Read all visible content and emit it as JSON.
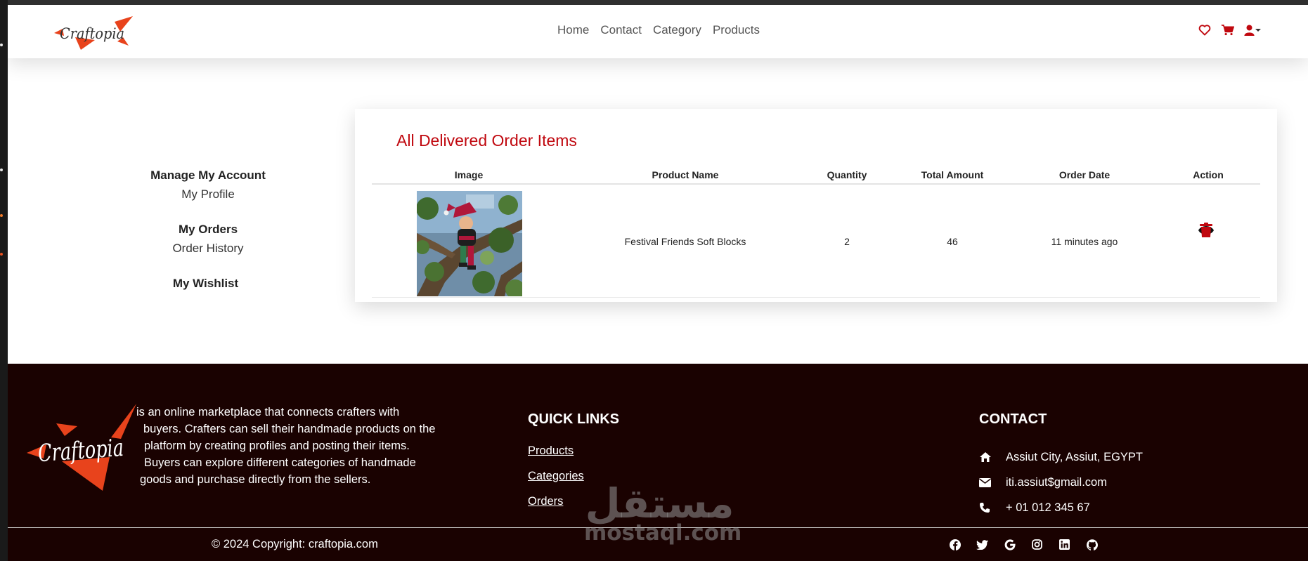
{
  "brand": {
    "logo_text": "Craftopia"
  },
  "nav": {
    "links": [
      "Home",
      "Contact",
      "Category",
      "Products"
    ]
  },
  "nav_icons": [
    "heart-icon",
    "cart-icon",
    "user-icon",
    "caret-down-icon"
  ],
  "sidebar": {
    "account_heading": "Manage My Account",
    "profile_link": "My Profile",
    "orders_heading": "My Orders",
    "history_link": "Order History",
    "wishlist_heading": "My Wishlist"
  },
  "orders_table": {
    "title": "All Delivered Order Items",
    "columns": [
      "Image",
      "Product Name",
      "Quantity",
      "Total Amount",
      "Order Date",
      "Action"
    ],
    "rows": [
      {
        "product_name": "Festival Friends Soft Blocks",
        "quantity": "2",
        "total_amount": "46",
        "order_date": "11 minutes ago",
        "actions": [
          "eye-icon",
          "trash-icon"
        ]
      }
    ]
  },
  "footer": {
    "description": [
      "is an online marketplace that connects crafters with",
      "buyers. Crafters can sell their handmade products on the",
      "platform by creating profiles and posting their items.",
      "Buyers can explore different categories of handmade",
      "goods and purchase directly from the sellers."
    ],
    "quick_links_heading": "QUICK LINKS",
    "quick_links": [
      "Products",
      "Categories",
      "Orders"
    ],
    "contact_heading": "CONTACT",
    "contact": {
      "address": "Assiut City, Assiut, EGYPT",
      "email": "iti.assiut$gmail.com",
      "phone": "+ 01 012 345 67"
    },
    "copyright": "© 2024 Copyright: craftopia.com",
    "social_icons": [
      "facebook-icon",
      "twitter-icon",
      "google-icon",
      "instagram-icon",
      "linkedin-icon",
      "github-icon"
    ]
  },
  "watermark": {
    "arabic": "مستقل",
    "latin": "mostaql.com"
  },
  "colors": {
    "accent_red": "#c0080f",
    "footer_bg": "#1a0201",
    "logo_orange": "#e8431c"
  }
}
